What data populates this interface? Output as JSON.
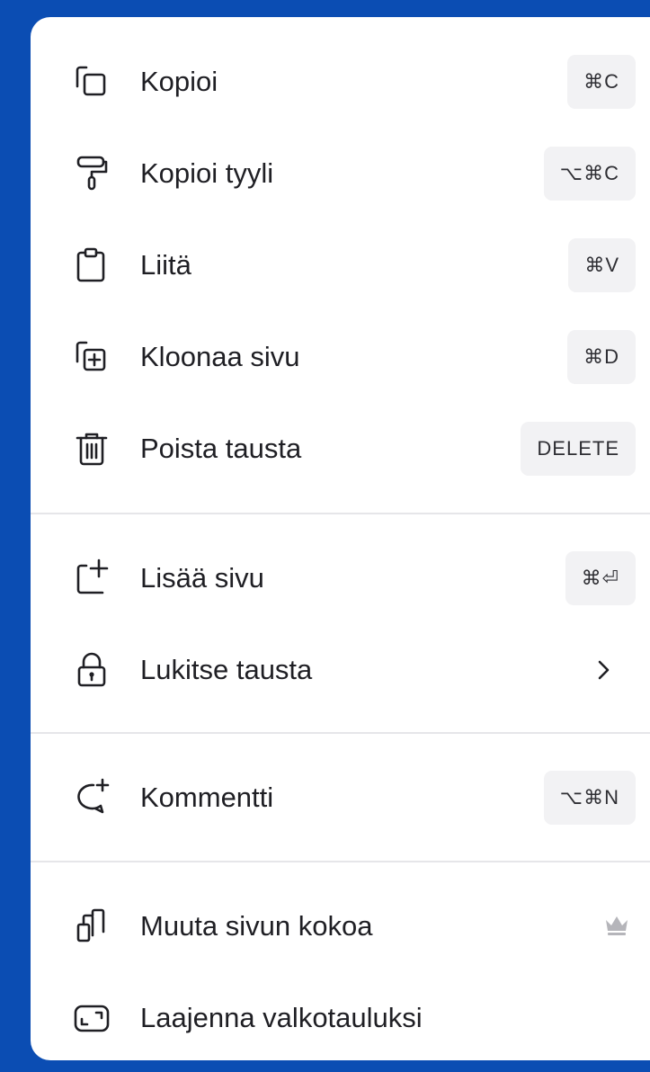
{
  "menu": {
    "items": [
      {
        "label": "Kopioi",
        "icon": "copy-icon",
        "shortcut": "⌘C"
      },
      {
        "label": "Kopioi tyyli",
        "icon": "paint-roller-icon",
        "shortcut": "⌥⌘C"
      },
      {
        "label": "Liitä",
        "icon": "clipboard-icon",
        "shortcut": "⌘V"
      },
      {
        "label": "Kloonaa sivu",
        "icon": "duplicate-page-icon",
        "shortcut": "⌘D"
      },
      {
        "label": "Poista tausta",
        "icon": "trash-icon",
        "shortcut": "DELETE"
      },
      {
        "label": "Lisää sivu",
        "icon": "add-page-icon",
        "shortcut": "⌘⏎"
      },
      {
        "label": "Lukitse tausta",
        "icon": "lock-icon",
        "trailing": "chevron-right-icon"
      },
      {
        "label": "Kommentti",
        "icon": "add-comment-icon",
        "shortcut": "⌥⌘N"
      },
      {
        "label": "Muuta sivun kokoa",
        "icon": "resize-icon",
        "trailing": "crown-icon"
      },
      {
        "label": "Laajenna valkotauluksi",
        "icon": "expand-whiteboard-icon"
      }
    ]
  },
  "colors": {
    "frame": "#0b4db3",
    "menu_background": "#ffffff",
    "text": "#1f1f24",
    "shortcut_background": "#f2f2f4",
    "divider": "#e6e6e9",
    "crown": "#b5b5ba"
  }
}
